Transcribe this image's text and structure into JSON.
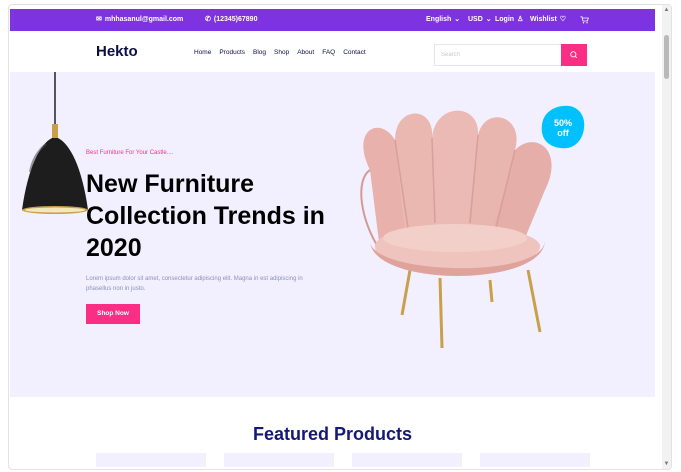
{
  "topbar": {
    "email": "mhhasanul@gmail.com",
    "phone": "(12345)67890",
    "language": "English",
    "currency": "USD",
    "login": "Login",
    "wishlist": "Wishlist"
  },
  "header": {
    "logo": "Hekto",
    "nav": [
      "Home",
      "Products",
      "Blog",
      "Shop",
      "About",
      "FAQ",
      "Contact"
    ],
    "search_placeholder": "Search"
  },
  "hero": {
    "subtitle": "Best Furniture For Your Castle....",
    "title": "New Furniture Collection Trends in 2020",
    "description": "Lorem ipsum dolor sit amet, consectetur adipiscing elit. Magna in est adipiscing in phasellus non in justo.",
    "button": "Shop Now",
    "badge_line1": "50%",
    "badge_line2": "off"
  },
  "featured": {
    "title": "Featured Products"
  },
  "colors": {
    "purple": "#7e33e0",
    "pink": "#fb2e86",
    "navy": "#151875",
    "hero_bg": "#f2f0ff",
    "badge": "#00c1fe"
  },
  "icons": [
    "mail-icon",
    "phone-icon",
    "chevron-down-icon",
    "user-icon",
    "heart-icon",
    "cart-icon",
    "search-icon"
  ]
}
